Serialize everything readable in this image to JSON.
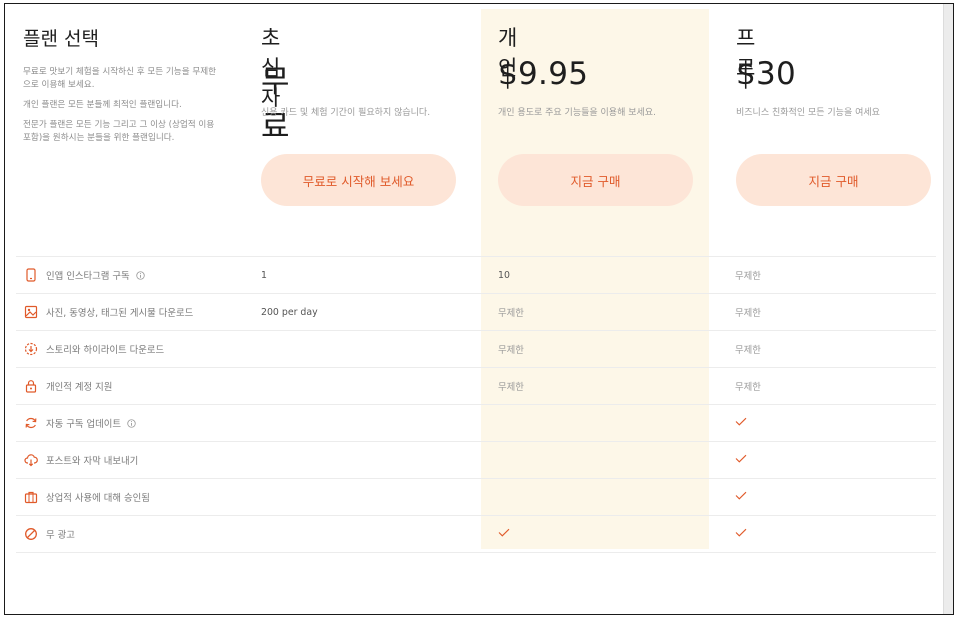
{
  "intro": {
    "title": "플랜 선택",
    "para1": "무료로 맛보기 체험을 시작하신 후 모든 기능을 무제한으로 이용해 보세요.",
    "para2": "개인 플랜은 모든 분들께 최적인 플랜입니다.",
    "para3": "전문가 플랜은 모든 기능 그리고 그 이상 (상업적 이용 포함)을 원하시는 분들을 위한 플랜입니다."
  },
  "plans": [
    {
      "name": "초심자",
      "price": "무료",
      "subtitle": "신용 카드 및 체험 기간이 필요하지 않습니다.",
      "cta": "무료로 시작해 보세요"
    },
    {
      "name": "개인",
      "price": "$9.95",
      "subtitle": "개인 용도로 주요 기능들을 이용해 보세요.",
      "cta": "지금 구매"
    },
    {
      "name": "프로",
      "price": "$30",
      "subtitle": "비즈니스 친화적인 모든 기능을 여세요",
      "cta": "지금 구매"
    }
  ],
  "features": [
    {
      "label": "인앱 인스타그램 구독",
      "icon": "phone-icon",
      "info": true,
      "values": [
        "1",
        "10",
        "무제한"
      ]
    },
    {
      "label": "사진, 동영상, 태그된 게시물 다운로드",
      "icon": "image-icon",
      "info": false,
      "values": [
        "200 per day",
        "무제한",
        "무제한"
      ]
    },
    {
      "label": "스토리와 하이라이트 다운로드",
      "icon": "story-download-icon",
      "info": false,
      "values": [
        "",
        "무제한",
        "무제한"
      ]
    },
    {
      "label": "개인적 계정 지원",
      "icon": "lock-icon",
      "info": false,
      "values": [
        "",
        "무제한",
        "무제한"
      ]
    },
    {
      "label": "자동 구독 업데이트",
      "icon": "refresh-icon",
      "info": true,
      "values": [
        "",
        "",
        "check"
      ]
    },
    {
      "label": "포스트와 자막 내보내기",
      "icon": "cloud-download-icon",
      "info": false,
      "values": [
        "",
        "",
        "check"
      ]
    },
    {
      "label": "상업적 사용에 대해 승인됨",
      "icon": "briefcase-icon",
      "info": false,
      "values": [
        "",
        "",
        "check"
      ]
    },
    {
      "label": "무 광고",
      "icon": "no-ads-icon",
      "info": false,
      "values": [
        "",
        "check",
        "check"
      ]
    }
  ],
  "colors": {
    "accent": "#e05a2a",
    "cta_bg": "#fde5d7",
    "highlight": "#fdf7e8"
  }
}
